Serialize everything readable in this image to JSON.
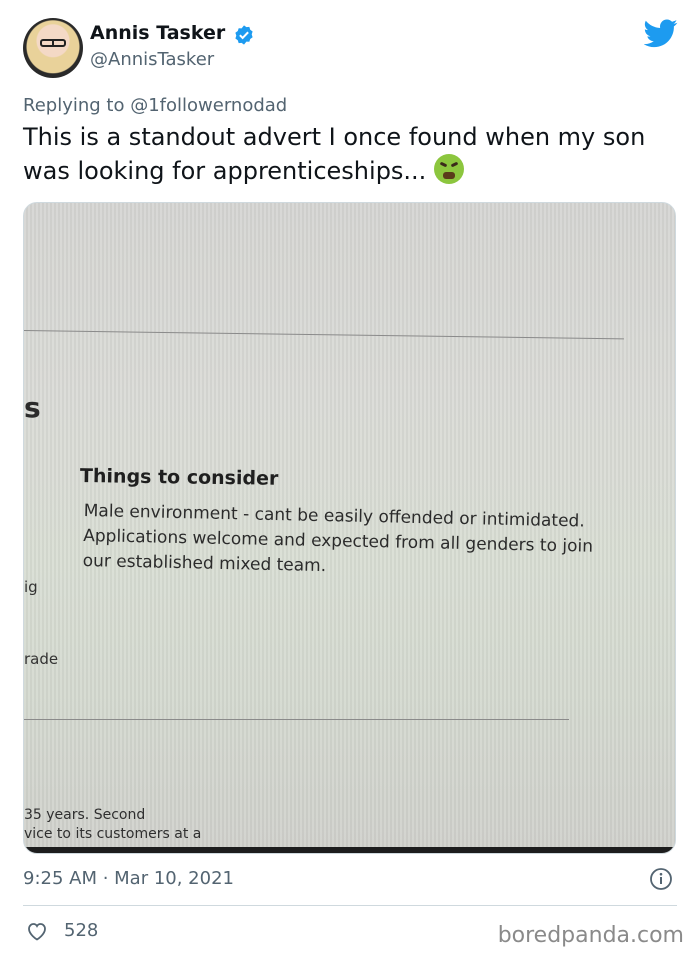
{
  "author": {
    "display_name": "Annis Tasker",
    "handle": "@AnnisTasker",
    "verified": true
  },
  "reply": {
    "prefix": "Replying to",
    "mention": "@1followernodad"
  },
  "tweet": {
    "text": "This is a standout advert I once found when my son was looking for apprenticeships..."
  },
  "photo": {
    "section_letter": "s",
    "heading": "Things to consider",
    "body": "Male environment - cant be easily offended or intimidated. Applications welcome and expected from all genders to join our established mixed team.",
    "fragment_ig": "ig",
    "fragment_rade": "rade",
    "bottom_line_1": "35 years. Second",
    "bottom_line_2": "vice to its customers at a"
  },
  "meta": {
    "timestamp": "9:25 AM · Mar 10, 2021",
    "like_count": "528"
  },
  "watermark": "boredpanda.com",
  "colors": {
    "twitter_blue": "#1d9bf0",
    "secondary_text": "#536471"
  }
}
